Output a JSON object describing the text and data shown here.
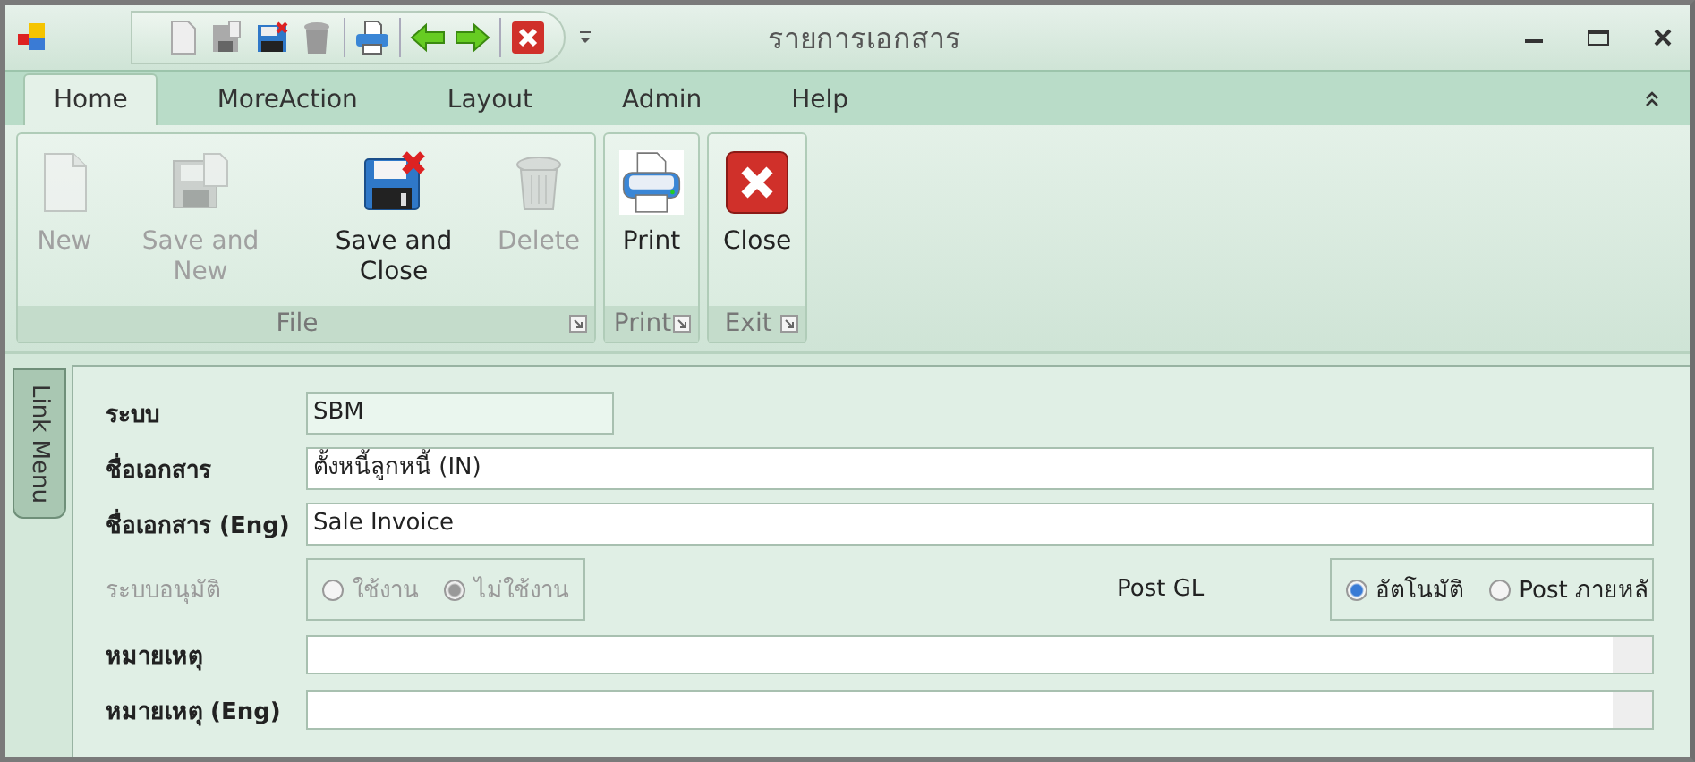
{
  "window": {
    "title": "รายการเอกสาร"
  },
  "tabs": [
    {
      "label": "Home",
      "selected": true
    },
    {
      "label": "MoreAction",
      "selected": false
    },
    {
      "label": "Layout",
      "selected": false
    },
    {
      "label": "Admin",
      "selected": false
    },
    {
      "label": "Help",
      "selected": false
    }
  ],
  "ribbon_groups": [
    {
      "label": "File",
      "buttons": [
        {
          "label": "New",
          "kind": "new",
          "disabled": true
        },
        {
          "label": "Save and New",
          "kind": "save-new",
          "disabled": true
        },
        {
          "label": "Save and Close",
          "kind": "save-close",
          "disabled": false
        },
        {
          "label": "Delete",
          "kind": "delete",
          "disabled": true
        }
      ]
    },
    {
      "label": "Print",
      "buttons": [
        {
          "label": "Print",
          "kind": "print",
          "disabled": false
        }
      ]
    },
    {
      "label": "Exit",
      "buttons": [
        {
          "label": "Close",
          "kind": "close",
          "disabled": false
        }
      ]
    }
  ],
  "side_tab": {
    "label": "Link Menu"
  },
  "form": [
    {
      "kind": "text",
      "label": "ระบบ",
      "value": "SBM",
      "readonly": true
    },
    {
      "kind": "text",
      "label": "ชื่อเอกสาร",
      "value": "ตั้งหนี้ลูกหนี้ (IN)",
      "readonly": false
    },
    {
      "kind": "text",
      "label": "ชื่อเอกสาร (Eng)",
      "value": "Sale Invoice",
      "readonly": false
    },
    {
      "kind": "radios",
      "label": "ระบบอนุมัติ",
      "disabled": true,
      "options": [
        {
          "label": "ใช้งาน",
          "selected": false
        },
        {
          "label": "ไม่ใช้งาน",
          "selected": true
        }
      ],
      "second_label": "Post GL",
      "second_options": [
        {
          "label": "อัตโนมัติ",
          "selected": true
        },
        {
          "label": "Post ภายหลั",
          "selected": false
        }
      ]
    },
    {
      "kind": "memo",
      "label": "หมายเหตุ"
    },
    {
      "kind": "memo",
      "label": "หมายเหตุ (Eng)"
    }
  ]
}
